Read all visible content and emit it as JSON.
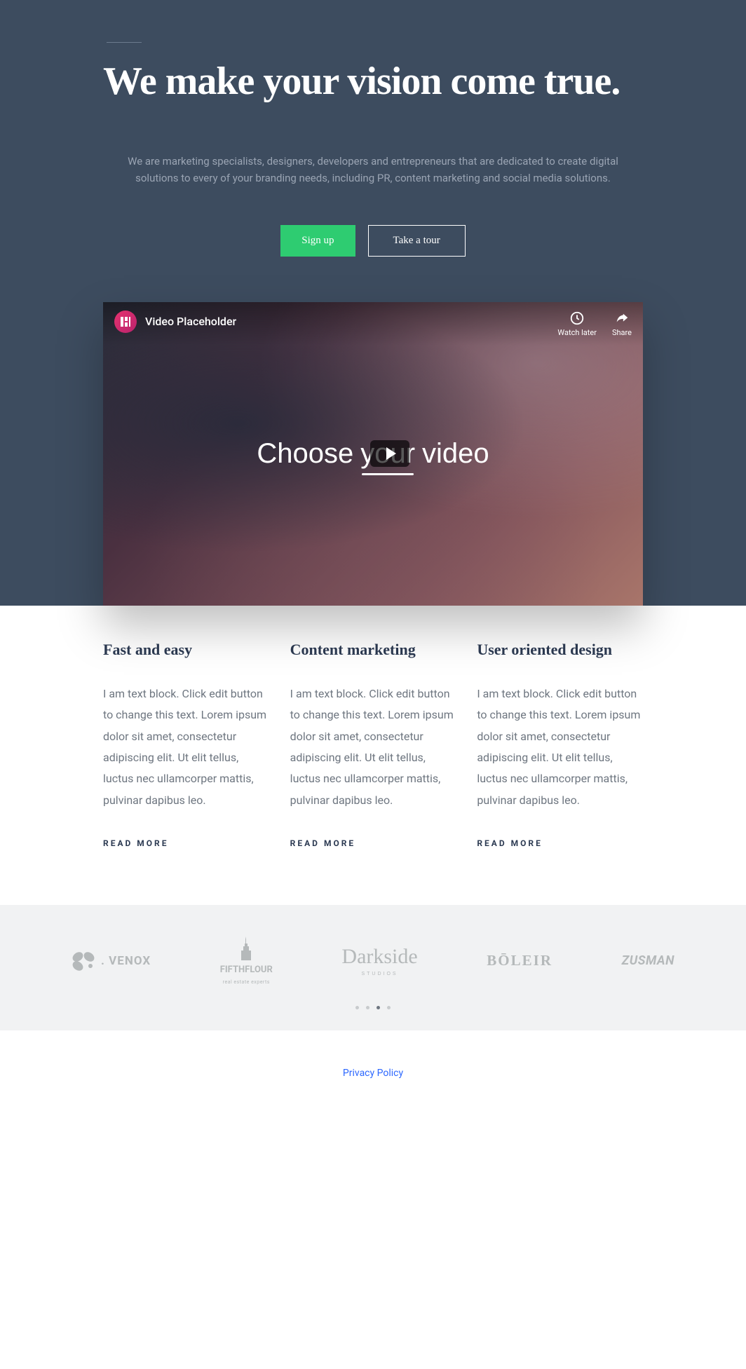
{
  "hero": {
    "title": "We make your vision come true.",
    "subtitle": "We are marketing specialists, designers, developers and entrepreneurs that are dedicated to create digital solutions to every of your branding needs, including PR, content marketing and social media solutions.",
    "signup_label": "Sign up",
    "tour_label": "Take a tour"
  },
  "video": {
    "title": "Video Placeholder",
    "watch_later": "Watch later",
    "share": "Share",
    "text_choose": "Choose",
    "text_yo": "yo",
    "text_ur": "ur",
    "text_video": "video"
  },
  "features": [
    {
      "title": "Fast and easy",
      "body": "I am text block. Click edit button to change this text. Lorem ipsum dolor sit amet, consectetur adipiscing elit. Ut elit tellus, luctus nec ullamcorper mattis, pulvinar dapibus leo.",
      "cta": "READ MORE"
    },
    {
      "title": "Content marketing",
      "body": "I am text block. Click edit button to change this text. Lorem ipsum dolor sit amet, consectetur adipiscing elit. Ut elit tellus, luctus nec ullamcorper mattis, pulvinar dapibus leo.",
      "cta": "READ MORE"
    },
    {
      "title": "User oriented design",
      "body": "I am text block. Click edit button to change this text. Lorem ipsum dolor sit amet, consectetur adipiscing elit. Ut elit tellus, luctus nec ullamcorper mattis, pulvinar dapibus leo.",
      "cta": "READ MORE"
    }
  ],
  "logos": {
    "venox": ". VENOX",
    "fifthflour": "FIFTHFLOUR",
    "fifthflour_sub": "real estate experts",
    "darkside": "Darkside",
    "darkside_sub": "STUDIOS",
    "boleir": "BŌLEIR",
    "zusman": "ZUSMAN",
    "active_dot_index": 2
  },
  "footer": {
    "privacy": "Privacy Policy"
  }
}
